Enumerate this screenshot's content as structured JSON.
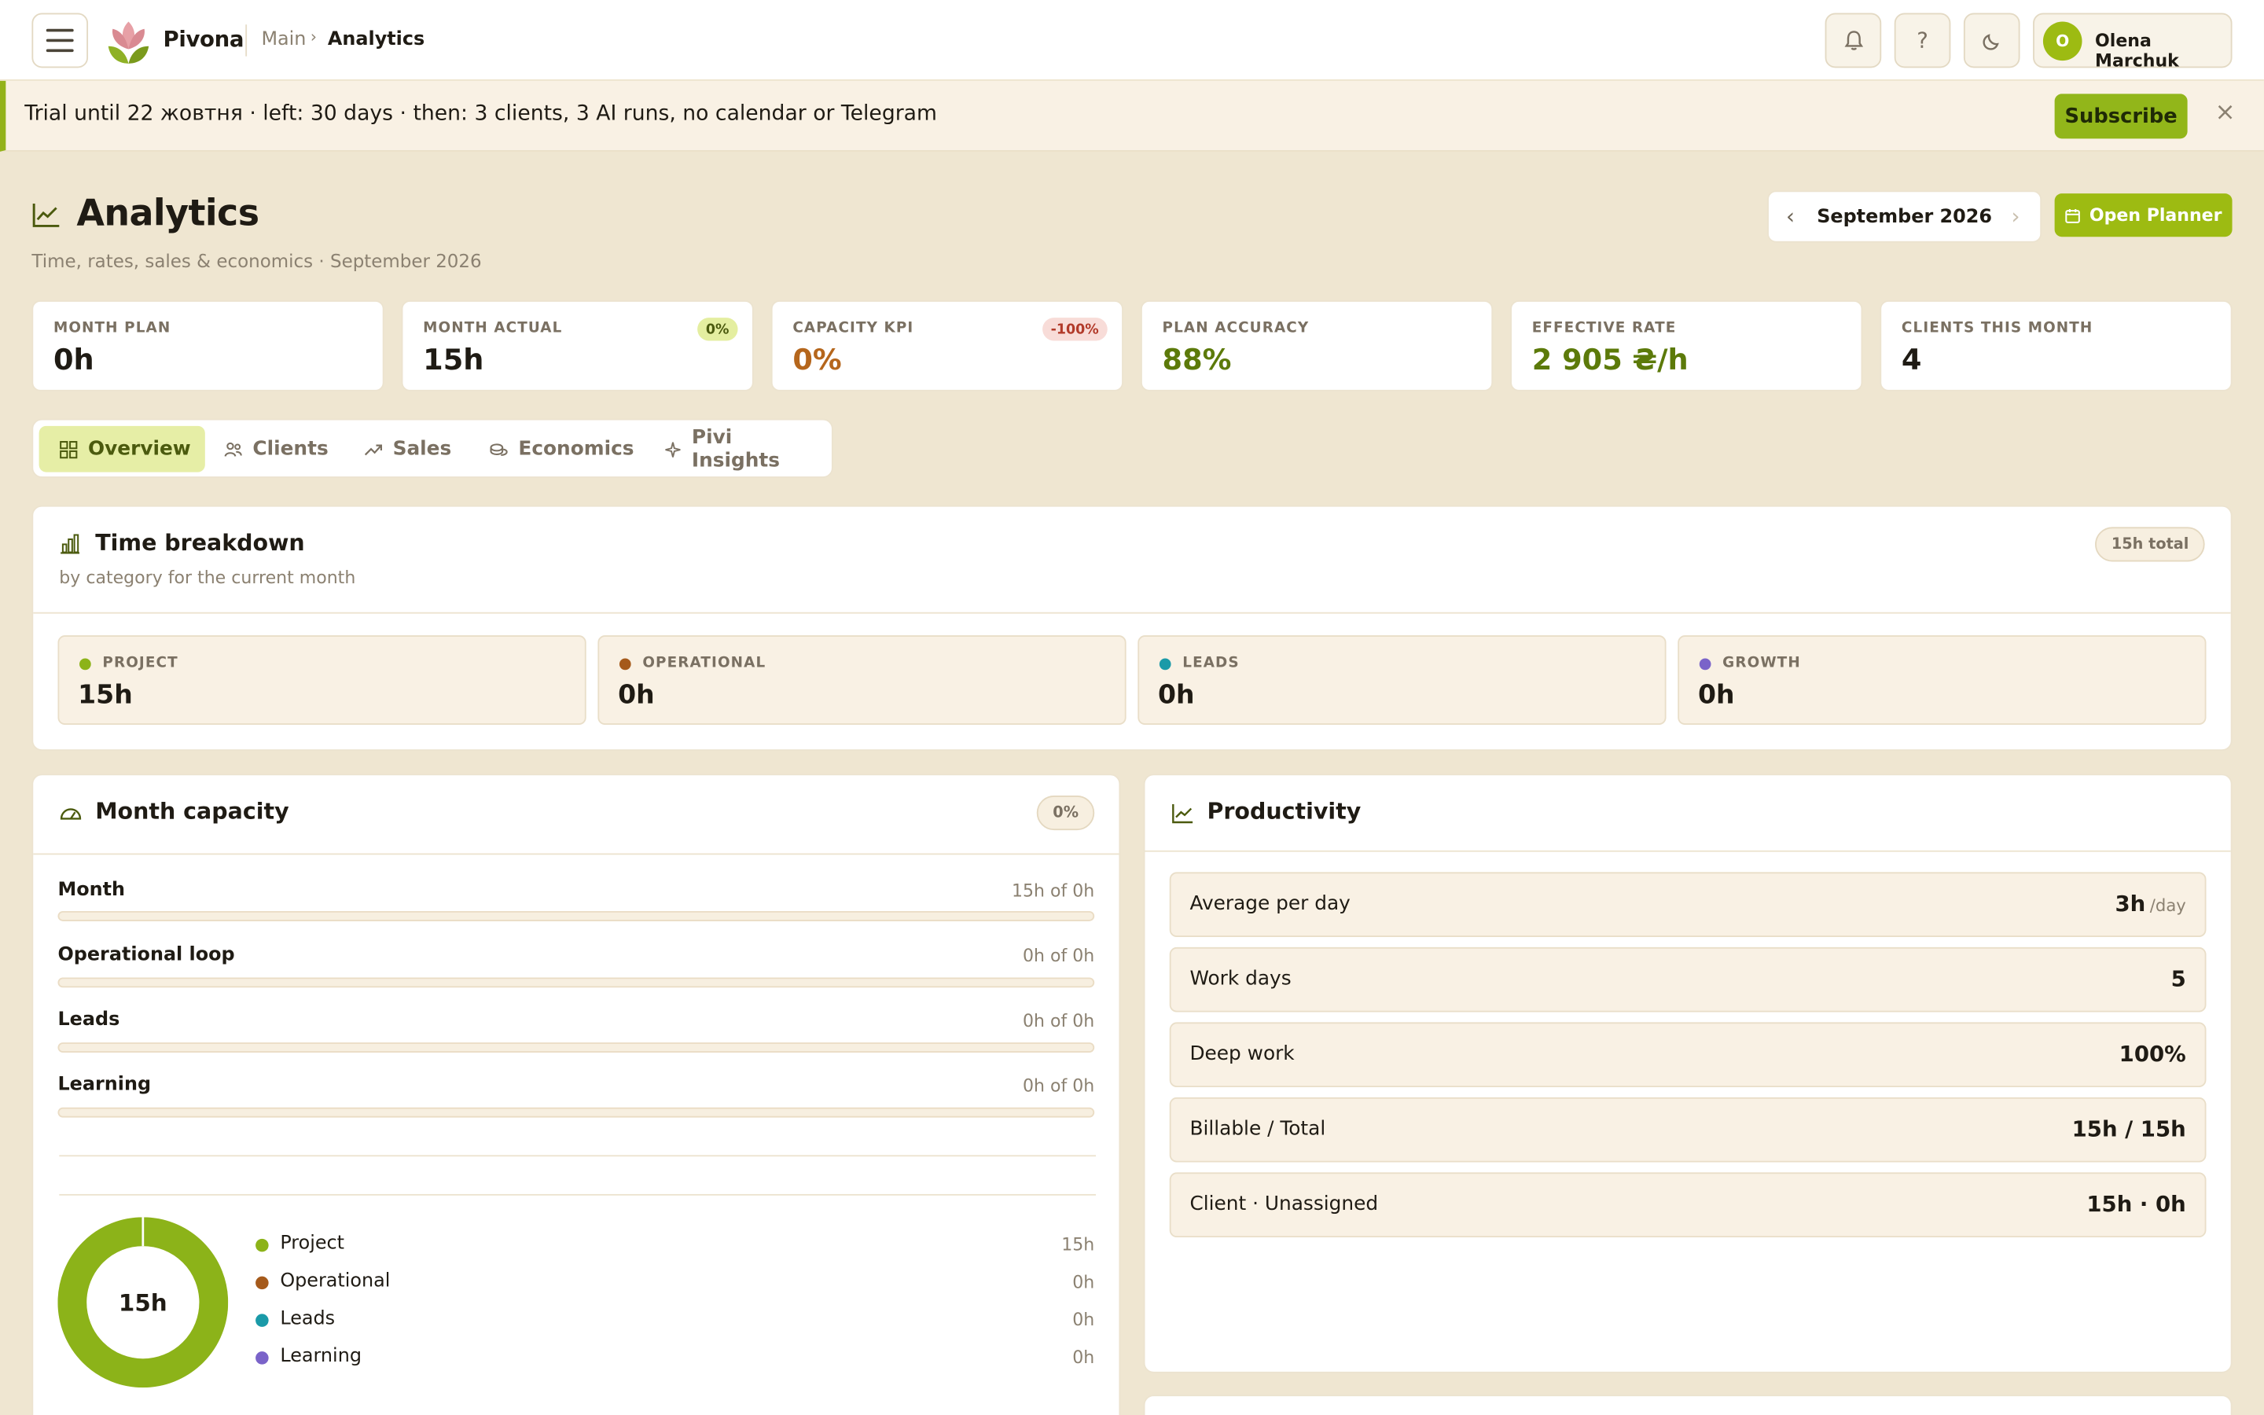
{
  "app": {
    "brand": "Pivona"
  },
  "breadcrumb": {
    "main": "Main",
    "sep": "›",
    "current": "Analytics"
  },
  "header": {
    "help": "?",
    "user_initial": "O",
    "user_name": "Olena Marchuk"
  },
  "banner": {
    "text": "Trial until 22 жовтня · left: 30 days · then: 3 clients, 3 AI runs, no calendar or Telegram",
    "subscribe": "Subscribe",
    "close": "×"
  },
  "page": {
    "title": "Analytics",
    "subtitle": "Time, rates, sales & economics · September 2026",
    "month": "September 2026",
    "open_planner": "Open Planner"
  },
  "kpis": [
    {
      "label": "MONTH PLAN",
      "value": "0h",
      "color": "#1f1b14"
    },
    {
      "label": "MONTH ACTUAL",
      "value": "15h",
      "badge": "0%",
      "color": "#1f1b14"
    },
    {
      "label": "CAPACITY KPI",
      "value": "0%",
      "badge": "-100%",
      "color": "#b5661c"
    },
    {
      "label": "PLAN ACCURACY",
      "value": "88%",
      "color": "#5c7a0a"
    },
    {
      "label": "EFFECTIVE RATE",
      "value": "2 905 ₴/h",
      "color": "#5c7a0a"
    },
    {
      "label": "CLIENTS THIS MONTH",
      "value": "4",
      "color": "#1f1b14"
    }
  ],
  "tabs": [
    {
      "label": "Overview",
      "icon": "grid-icon",
      "active": true
    },
    {
      "label": "Clients",
      "icon": "users-icon"
    },
    {
      "label": "Sales",
      "icon": "trend-up-icon"
    },
    {
      "label": "Economics",
      "icon": "coins-icon"
    },
    {
      "label": "Pivi Insights",
      "icon": "sparkle-icon"
    }
  ],
  "time_breakdown": {
    "title": "Time breakdown",
    "subtitle": "by category for the current month",
    "total": "15h total",
    "categories": [
      {
        "label": "PROJECT",
        "value": "15h",
        "color": "#8cb319"
      },
      {
        "label": "OPERATIONAL",
        "value": "0h",
        "color": "#a55a1b"
      },
      {
        "label": "LEADS",
        "value": "0h",
        "color": "#1a9aa8"
      },
      {
        "label": "GROWTH",
        "value": "0h",
        "color": "#7a63c9"
      }
    ]
  },
  "capacity": {
    "title": "Month capacity",
    "badge": "0%",
    "rows": [
      {
        "label": "Month",
        "value": "15h of 0h",
        "fill": 0
      },
      {
        "label": "Operational loop",
        "value": "0h of 0h",
        "fill": 0
      },
      {
        "label": "Leads",
        "value": "0h of 0h",
        "fill": 0
      },
      {
        "label": "Learning",
        "value": "0h of 0h",
        "fill": 0
      }
    ],
    "donut_center": "15h",
    "legend": [
      {
        "label": "Project",
        "value": "15h",
        "color": "#8cb319",
        "hours": 15
      },
      {
        "label": "Operational",
        "value": "0h",
        "color": "#a55a1b",
        "hours": 0
      },
      {
        "label": "Leads",
        "value": "0h",
        "color": "#1a9aa8",
        "hours": 0
      },
      {
        "label": "Learning",
        "value": "0h",
        "color": "#7a63c9",
        "hours": 0
      }
    ]
  },
  "productivity": {
    "title": "Productivity",
    "rows": [
      {
        "label": "Average per day",
        "value": "3h",
        "unit": "/day"
      },
      {
        "label": "Work days",
        "value": "5"
      },
      {
        "label": "Deep work",
        "value": "100%"
      },
      {
        "label": "Billable / Total",
        "value": "15h / 15h"
      },
      {
        "label": "Client · Unassigned",
        "value": "15h · 0h"
      }
    ]
  },
  "colors": {
    "accent": "#9dbb12",
    "background": "#efe6d1",
    "card": "#ffffff"
  }
}
